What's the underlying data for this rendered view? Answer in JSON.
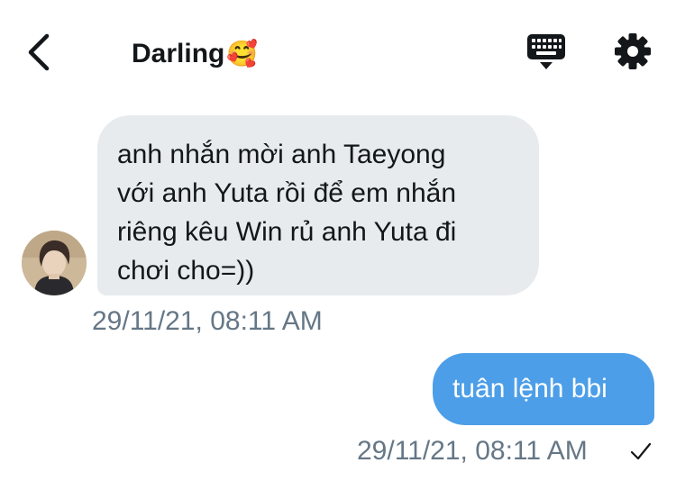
{
  "header": {
    "title": "Darling",
    "title_emoji": "🥰",
    "back_icon": "chevron-left-icon",
    "keyboard_icon": "keyboard-icon",
    "settings_icon": "gear-icon"
  },
  "messages": [
    {
      "direction": "incoming",
      "text": "anh nhắn mời anh Taeyong\nvới anh Yuta rồi để em nhắn\nriêng kêu Win rủ anh Yuta đi\nchơi cho=))",
      "timestamp": "29/11/21, 08:11 AM",
      "bubble_color": "#e8ebee"
    },
    {
      "direction": "outgoing",
      "text": "tuân lệnh bbi",
      "timestamp": "29/11/21, 08:11 AM",
      "status_icon": "checkmark-icon",
      "bubble_color": "#4c9ee8"
    }
  ],
  "colors": {
    "text_primary": "#14171a",
    "text_secondary": "#657786",
    "accent": "#4c9ee8"
  }
}
